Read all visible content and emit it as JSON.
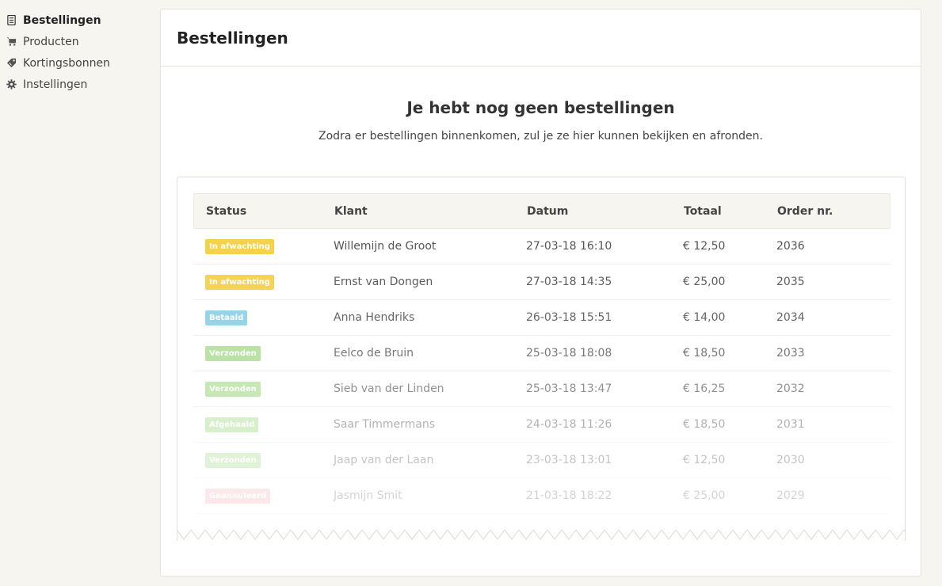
{
  "sidebar": {
    "items": [
      {
        "label": "Bestellingen",
        "icon": "document-icon",
        "active": true
      },
      {
        "label": "Producten",
        "icon": "cart-icon",
        "active": false
      },
      {
        "label": "Kortingsbonnen",
        "icon": "tag-icon",
        "active": false
      },
      {
        "label": "Instellingen",
        "icon": "gear-icon",
        "active": false
      }
    ]
  },
  "panel": {
    "title": "Bestellingen",
    "empty_title": "Je hebt nog geen bestellingen",
    "empty_text": "Zodra er bestellingen binnenkomen, zul je ze hier kunnen bekijken en afronden."
  },
  "table": {
    "headers": [
      "Status",
      "Klant",
      "Datum",
      "Totaal",
      "Order nr."
    ],
    "rows": [
      {
        "status": "In afwachting",
        "status_color": "#f5d24a",
        "klant": "Willemijn de Groot",
        "datum": "27-03-18 16:10",
        "totaal": "€ 12,50",
        "order": "2036"
      },
      {
        "status": "In afwachting",
        "status_color": "#f5d24a",
        "klant": "Ernst van Dongen",
        "datum": "27-03-18 14:35",
        "totaal": "€ 25,00",
        "order": "2035"
      },
      {
        "status": "Betaald",
        "status_color": "#8dd0e6",
        "klant": "Anna Hendriks",
        "datum": "26-03-18 15:51",
        "totaal": "€ 14,00",
        "order": "2034"
      },
      {
        "status": "Verzonden",
        "status_color": "#a9dc8f",
        "klant": "Eelco de Bruin",
        "datum": "25-03-18 18:08",
        "totaal": "€ 18,50",
        "order": "2033"
      },
      {
        "status": "Verzonden",
        "status_color": "#a9dc8f",
        "klant": "Sieb van der Linden",
        "datum": "25-03-18 13:47",
        "totaal": "€ 16,25",
        "order": "2032"
      },
      {
        "status": "Afgehaald",
        "status_color": "#a9dc8f",
        "klant": "Saar Timmermans",
        "datum": "24-03-18 11:26",
        "totaal": "€ 18,50",
        "order": "2031"
      },
      {
        "status": "Verzonden",
        "status_color": "#a9dc8f",
        "klant": "Jaap van der Laan",
        "datum": "23-03-18 13:01",
        "totaal": "€ 12,50",
        "order": "2030"
      },
      {
        "status": "Geannuleerd",
        "status_color": "#f4a7ad",
        "klant": "Jasmijn Smit",
        "datum": "21-03-18 18:22",
        "totaal": "€ 25,00",
        "order": "2029"
      }
    ]
  }
}
